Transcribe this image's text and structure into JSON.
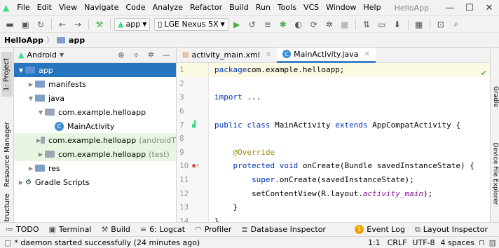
{
  "menu": [
    "File",
    "Edit",
    "View",
    "Navigate",
    "Code",
    "Analyze",
    "Refactor",
    "Build",
    "Run",
    "Tools",
    "VCS",
    "Window",
    "Help"
  ],
  "window_title": "HelloApp",
  "window_controls": {
    "minimize": "—",
    "maximize": "☐",
    "close": "✕"
  },
  "toolbar": {
    "config": "app",
    "device": "LGE Nexus 5X"
  },
  "breadcrumb": {
    "project": "HelloApp",
    "module": "app"
  },
  "sidebar_tabs": {
    "project": "1: Project",
    "resource_manager": "Resource Manager",
    "structure": "Structure"
  },
  "right_tabs": {
    "gradle": "Gradle",
    "device_file": "Device File Explorer"
  },
  "project_panel": {
    "view": "Android",
    "tree": [
      {
        "label": "app",
        "dim": "",
        "indent": 0,
        "arrow": "▼",
        "color": "#5c8fd6",
        "selected": true,
        "test": false
      },
      {
        "label": "manifests",
        "dim": "",
        "indent": 1,
        "arrow": "▶",
        "color": "#7e9fc8",
        "selected": false,
        "test": false
      },
      {
        "label": "java",
        "dim": "",
        "indent": 1,
        "arrow": "▼",
        "color": "#7e9fc8",
        "selected": false,
        "test": false
      },
      {
        "label": "com.example.helloapp",
        "dim": "",
        "indent": 2,
        "arrow": "▼",
        "color": "#9aa6b2",
        "selected": false,
        "test": false
      },
      {
        "label": "MainActivity",
        "dim": "",
        "indent": 3,
        "arrow": "",
        "color": "class",
        "selected": false,
        "test": false
      },
      {
        "label": "com.example.helloapp",
        "dim": "(androidT",
        "indent": 2,
        "arrow": "▶",
        "color": "#9aa6b2",
        "selected": false,
        "test": true
      },
      {
        "label": "com.example.helloapp",
        "dim": "(test)",
        "indent": 2,
        "arrow": "▶",
        "color": "#9aa6b2",
        "selected": false,
        "test": true
      },
      {
        "label": "res",
        "dim": "",
        "indent": 1,
        "arrow": "▶",
        "color": "#7e9fc8",
        "selected": false,
        "test": false
      },
      {
        "label": "Gradle Scripts",
        "dim": "",
        "indent": 0,
        "arrow": "▶",
        "color": "gradle",
        "selected": false,
        "test": false
      }
    ]
  },
  "editor": {
    "tabs": [
      {
        "label": "activity_main.xml",
        "active": false
      },
      {
        "label": "MainActivity.java",
        "active": true
      }
    ],
    "lines": [
      {
        "n": "1",
        "parts": [
          [
            "kw",
            "package"
          ],
          [
            "",
            "com.example.helloapp;"
          ]
        ]
      },
      {
        "n": "2",
        "parts": []
      },
      {
        "n": "3",
        "parts": [
          [
            "kw",
            "import"
          ],
          [
            "",
            " ..."
          ]
        ]
      },
      {
        "n": "6",
        "parts": []
      },
      {
        "n": "7",
        "parts": [
          [
            "kw",
            "public class"
          ],
          [
            "",
            " MainActivity "
          ],
          [
            "kw",
            "extends"
          ],
          [
            "",
            " AppCompatActivity {"
          ]
        ]
      },
      {
        "n": "8",
        "parts": []
      },
      {
        "n": "9",
        "parts": [
          [
            "",
            "    "
          ],
          [
            "an",
            "@Override"
          ]
        ]
      },
      {
        "n": "10",
        "parts": [
          [
            "",
            "    "
          ],
          [
            "kw",
            "protected void"
          ],
          [
            "",
            " onCreate(Bundle savedInstanceState) {"
          ]
        ]
      },
      {
        "n": "11",
        "parts": [
          [
            "",
            "        "
          ],
          [
            "kw",
            "super"
          ],
          [
            "",
            ".onCreate(savedInstanceState);"
          ]
        ]
      },
      {
        "n": "12",
        "parts": [
          [
            "",
            "        setContentView(R.layout."
          ],
          [
            "it",
            "activity_main"
          ],
          [
            "",
            ");"
          ]
        ]
      },
      {
        "n": "13",
        "parts": [
          [
            "",
            "    }"
          ]
        ]
      },
      {
        "n": "14",
        "parts": [
          [
            "",
            "}"
          ]
        ]
      }
    ]
  },
  "bottom_tools": {
    "todo": "TODO",
    "terminal": "Terminal",
    "build": "Build",
    "logcat": "6: Logcat",
    "profiler": "Profiler",
    "db": "Database Inspector",
    "event_log": "Event Log",
    "layout_inspector": "Layout Inspector",
    "event_badge": "1"
  },
  "status": {
    "message": "* daemon started successfully (24 minutes ago)",
    "position": "1:1",
    "line_sep": "CRLF",
    "encoding": "UTF-8",
    "indent": "4 spaces"
  }
}
